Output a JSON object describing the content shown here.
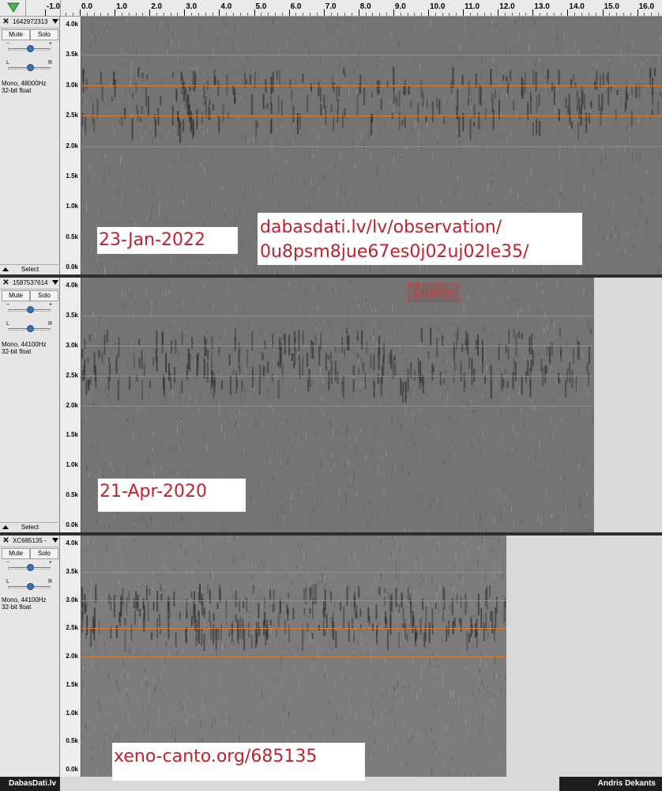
{
  "ruler": {
    "ticks": [
      "-1.0",
      "0.0",
      "1.0",
      "2.0",
      "3.0",
      "4.0",
      "5.0",
      "6.0",
      "7.0",
      "8.0",
      "9.0",
      "10.0",
      "11.0",
      "12.0",
      "13.0",
      "14.0",
      "15.0",
      "16.0"
    ]
  },
  "freq_labels": [
    "4.0k",
    "3.5k",
    "3.0k",
    "2.5k",
    "2.0k",
    "1.5k",
    "1.0k",
    "0.5k",
    "0.0k"
  ],
  "tracks": [
    {
      "name": "1642972313",
      "mute": "Mute",
      "solo": "Solo",
      "gain_minus": "−",
      "gain_plus": "+",
      "pan_l": "L",
      "pan_r": "R",
      "info_line1": "Mono, 48000Hz",
      "info_line2": "32-bit float",
      "select": "Select",
      "overlay_date": "23-Jan-2022",
      "overlay_url_line1": "dabasdati.lv/lv/observation/",
      "overlay_url_line2": "0u8psm8jue67es0j02uj02le35/"
    },
    {
      "name": "1587537614",
      "mute": "Mute",
      "solo": "Solo",
      "gain_minus": "−",
      "gain_plus": "+",
      "pan_l": "L",
      "pan_r": "R",
      "info_line1": "Mono, 44100Hz",
      "info_line2": "32-bit float",
      "select": "Select",
      "overlay_date": "21-Apr-2020",
      "stamp": "Žubīte"
    },
    {
      "name": "XC685135 -",
      "mute": "Mute",
      "solo": "Solo",
      "gain_minus": "−",
      "gain_plus": "+",
      "pan_l": "L",
      "pan_r": "R",
      "info_line1": "Mono, 44100Hz",
      "info_line2": "32-bit float",
      "overlay_url": "xeno-canto.org/685135"
    }
  ],
  "footer": {
    "left": "DabasDati.lv",
    "right": "Andris Dekants"
  },
  "colors": {
    "grid_line": "#e17b2f",
    "overlay_text": "#c0222c",
    "slider_knob": "#3d6fb6"
  }
}
